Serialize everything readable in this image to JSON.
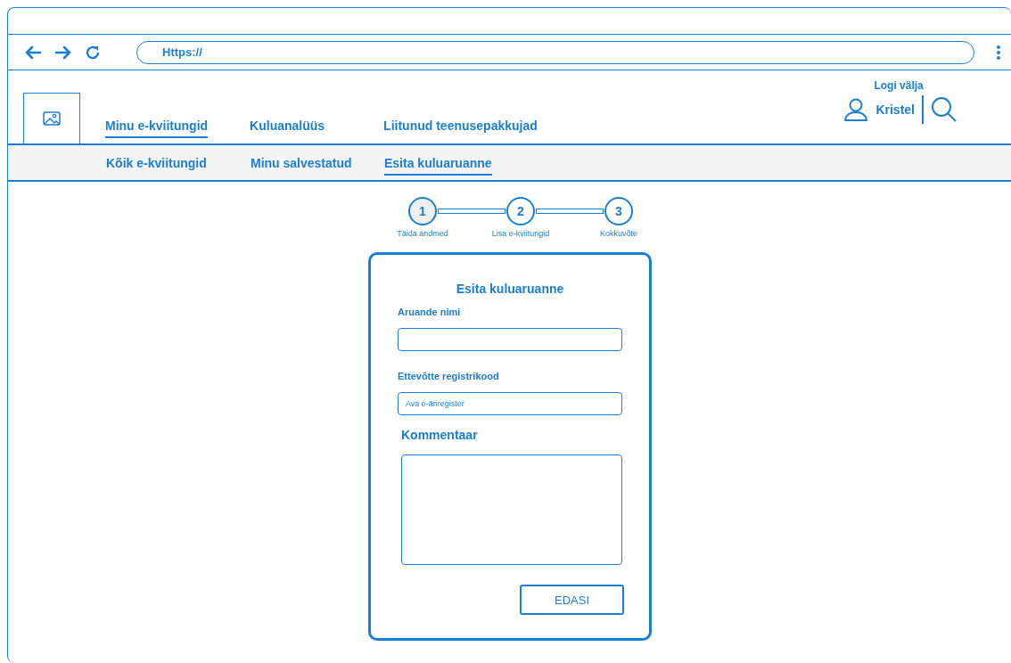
{
  "browser": {
    "url": "Https://"
  },
  "header": {
    "logout": "Logi välja",
    "user": "Kristel"
  },
  "nav": [
    {
      "label": "Minu e-kviitungid",
      "selected": true
    },
    {
      "label": "Kuluanalüüs",
      "selected": false
    },
    {
      "label": "Liitunud teenusepakkujad",
      "selected": false
    }
  ],
  "subnav": [
    {
      "label": "Kõik e-kviitungid",
      "selected": false
    },
    {
      "label": "Minu salvestatud",
      "selected": false
    },
    {
      "label": "Esita kuluaruanne",
      "selected": true
    }
  ],
  "steps": [
    {
      "number": "1",
      "label": "Täida andmed",
      "selected": true
    },
    {
      "number": "2",
      "label": "Lisa e-kviitungid",
      "selected": false
    },
    {
      "number": "3",
      "label": "Kokkuvõte",
      "selected": false
    }
  ],
  "form": {
    "title": "Esita kuluaruanne",
    "fields": [
      {
        "kind": "input",
        "label": "Aruande nimi"
      },
      {
        "kind": "input",
        "label": "Ettevõtte registrikood",
        "placeholder": "Ava e-äriregister"
      },
      {
        "kind": "textarea",
        "label": "Kommentaar"
      }
    ],
    "button": "EDASI"
  }
}
